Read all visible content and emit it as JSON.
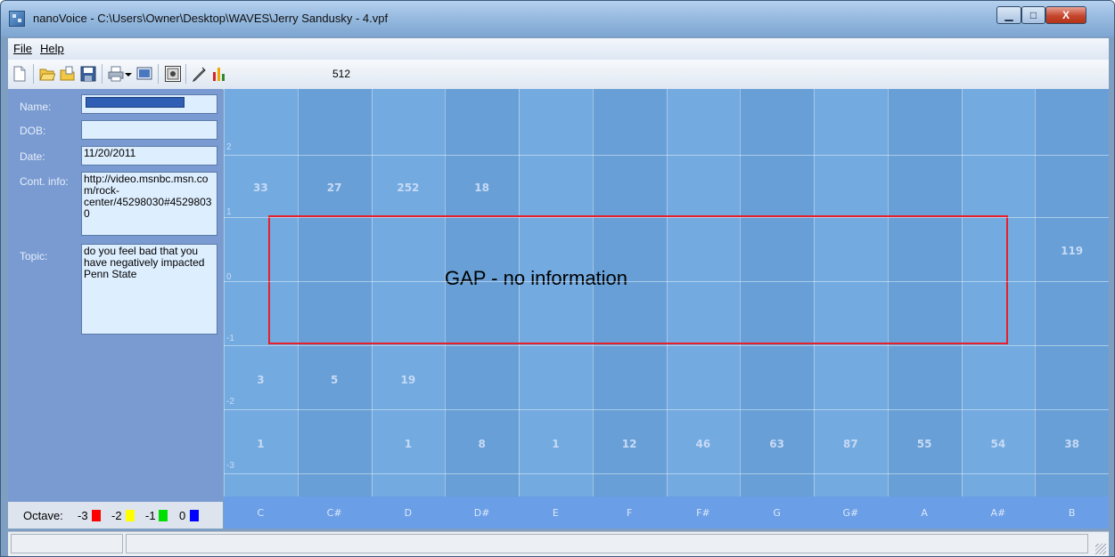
{
  "window": {
    "title": "nanoVoice - C:\\Users\\Owner\\Desktop\\WAVES\\Jerry Sandusky - 4.vpf",
    "caption_buttons": {
      "minimize": "▁",
      "maximize": "□",
      "close": "X"
    }
  },
  "menubar": {
    "file": "File",
    "help": "Help"
  },
  "toolbar": {
    "icons": [
      "new-document-icon",
      "open-folder-icon",
      "open-file-icon",
      "save-icon",
      "print-icon",
      "dropdown-arrow-icon",
      "print-preview-icon",
      "properties-icon",
      "pen-icon",
      "bar-chart-icon"
    ],
    "value": "512"
  },
  "form": {
    "name_label": "Name:",
    "name_value": "",
    "dob_label": "DOB:",
    "dob_value": "",
    "date_label": "Date:",
    "date_value": "11/20/2011",
    "cont_label": "Cont. info:",
    "cont_value": "http://video.msnbc.msn.com/rock-center/45298030#45298030",
    "topic_label": "Topic:",
    "topic_value": "do you feel bad that you have negatively impacted Penn State"
  },
  "octave_legend": {
    "label": "Octave:",
    "items": [
      {
        "num": "-3",
        "color": "#ff0000"
      },
      {
        "num": "-2",
        "color": "#ffff00"
      },
      {
        "num": "-1",
        "color": "#00e000"
      },
      {
        "num": "0",
        "color": "#0000ff"
      }
    ]
  },
  "grid": {
    "y_labels": [
      "2",
      "1",
      "0",
      "-1",
      "-2",
      "-3"
    ],
    "notes": [
      "C",
      "C#",
      "D",
      "D#",
      "E",
      "F",
      "F#",
      "G",
      "G#",
      "A",
      "A#",
      "B"
    ],
    "row_octave_1": [
      "33",
      "27",
      "252",
      "18",
      "",
      "",
      "",
      "",
      "",
      "",
      "",
      ""
    ],
    "row_octave_0": [
      "",
      "",
      "",
      "",
      "",
      "",
      "",
      "",
      "",
      "",
      "",
      "119"
    ],
    "row_octave_m2": [
      "3",
      "5",
      "19",
      "",
      "",
      "",
      "",
      "",
      "",
      "",
      "",
      ""
    ],
    "row_octave_m3": [
      "1",
      "",
      "1",
      "8",
      "1",
      "12",
      "46",
      "63",
      "87",
      "55",
      "54",
      "38"
    ]
  },
  "annotation": {
    "text": "GAP - no information",
    "border_color": "#e8202a"
  },
  "statusbar": {
    "pane1": "",
    "pane2": ""
  }
}
